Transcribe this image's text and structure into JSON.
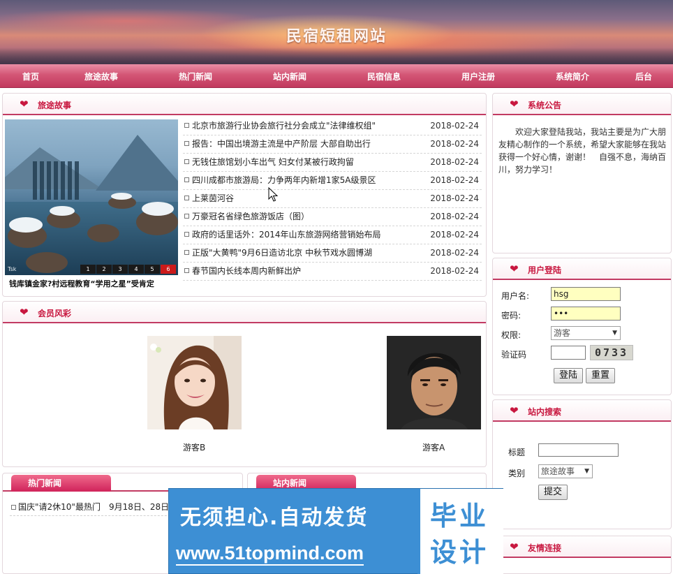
{
  "header": {
    "site_title": "民宿短租网站"
  },
  "nav": {
    "items": [
      {
        "label": "首页"
      },
      {
        "label": "旅途故事"
      },
      {
        "label": "热门新闻"
      },
      {
        "label": "站内新闻"
      },
      {
        "label": "民宿信息"
      },
      {
        "label": "用户注册"
      },
      {
        "label": "系统简介"
      },
      {
        "label": "后台"
      }
    ]
  },
  "travel": {
    "title": "旅途故事",
    "caption": "钱库镇金家?村远程教育“学用之星”受肯定",
    "slider_pages": [
      "1",
      "2",
      "3",
      "4",
      "5",
      "6"
    ],
    "active_page": "6",
    "news": [
      {
        "title": "北京市旅游行业协会旅行社分会成立\"法律维权组\"",
        "date": "2018-02-24"
      },
      {
        "title": "报告：中国出境游主流是中产阶层 大部自助出行",
        "date": "2018-02-24"
      },
      {
        "title": "无钱住旅馆划小车出气 妇女付某被行政拘留",
        "date": "2018-02-24"
      },
      {
        "title": "四川成都市旅游局：力争两年内新增1家5A级景区",
        "date": "2018-02-24"
      },
      {
        "title": "上莱茵河谷",
        "date": "2018-02-24"
      },
      {
        "title": "万豪冠名省绿色旅游饭店（图）",
        "date": "2018-02-24"
      },
      {
        "title": "政府的话里话外：2014年山东旅游网络营销始布局",
        "date": "2018-02-24"
      },
      {
        "title": "正版\"大黄鸭\"9月6日造访北京 中秋节戏水圆博湖",
        "date": "2018-02-24"
      },
      {
        "title": "春节国内长线本周内新鲜出炉",
        "date": "2018-02-24"
      }
    ]
  },
  "members": {
    "title": "会员风彩",
    "items": [
      {
        "name": "游客B"
      },
      {
        "name": "游客A"
      }
    ]
  },
  "hot_news": {
    "tab": "热门新闻",
    "items": [
      {
        "title": "国庆\"请2休10\"最热门　9月18日、28日请"
      }
    ]
  },
  "site_news": {
    "tab": "站内新闻"
  },
  "notice": {
    "title": "系统公告",
    "text": "欢迎大家登陆我站，我站主要是为广大朋友精心制作的一个系统，希望大家能够在我站获得一个好心情，谢谢！　自强不息，海纳百川，努力学习！"
  },
  "login": {
    "title": "用户登陆",
    "username_label": "用户名:",
    "username_value": "hsg",
    "password_label": "密码:",
    "password_value": "•••",
    "role_label": "权限:",
    "role_value": "游客",
    "captcha_label": "验证码",
    "captcha_value": "",
    "captcha_image_text": "0733",
    "login_button": "登陆",
    "reset_button": "重置"
  },
  "search": {
    "title": "站内搜索",
    "title_label": "标题",
    "title_value": "",
    "category_label": "类别",
    "category_value": "旅途故事",
    "submit_button": "提交"
  },
  "links": {
    "title": "友情连接"
  },
  "ad": {
    "headline": "无须担心.自动发货",
    "url": "www.51topmind.com",
    "box_line1": "毕业",
    "box_line2": "设计"
  },
  "colors": {
    "nav_bg": "#c2395e",
    "heading": "#c8173f",
    "tab_bg": "#d0235a",
    "ad_blue": "#3d8fd4",
    "input_yellow": "#ffffc0"
  }
}
